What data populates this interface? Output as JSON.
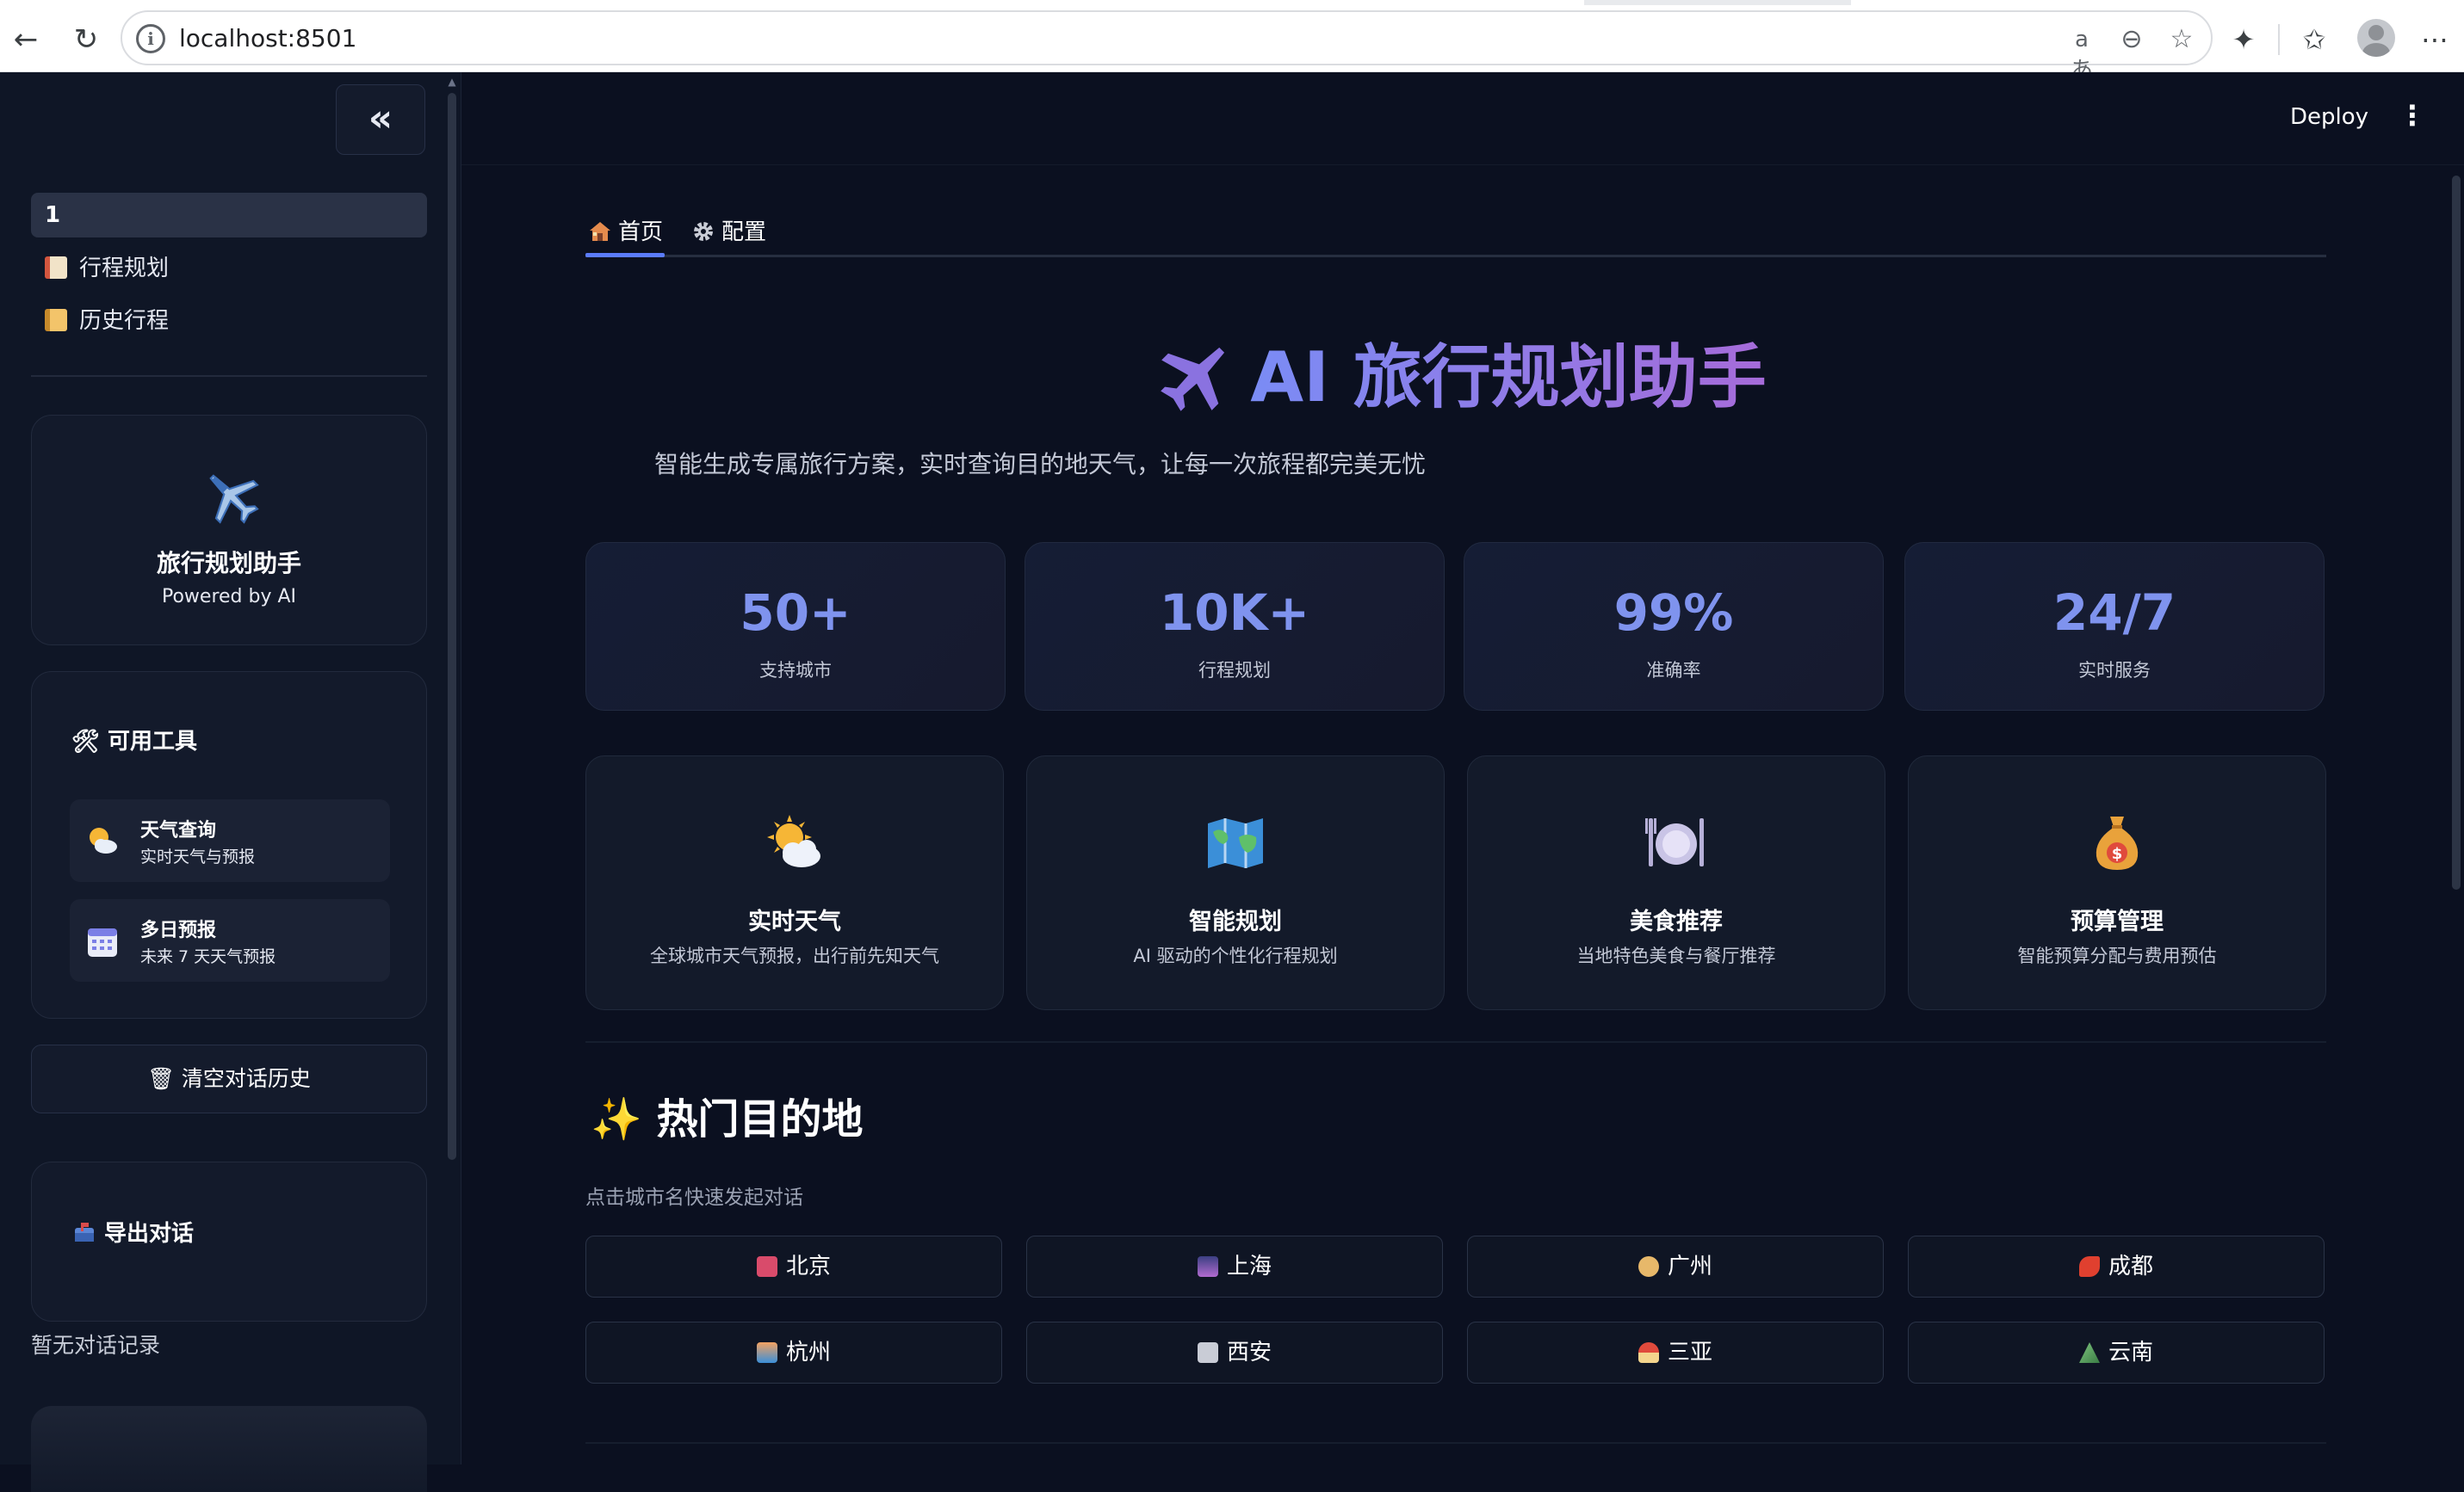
{
  "browser": {
    "url": "localhost:8501"
  },
  "sidebar": {
    "collapse_label": "«",
    "active_page": "1",
    "pages": [
      {
        "label": "行程规划"
      },
      {
        "label": "历史行程"
      }
    ],
    "brand": {
      "title": "旅行规划助手",
      "subtitle": "Powered by AI"
    },
    "tools": {
      "title": "🛠 可用工具",
      "items": [
        {
          "name": "天气查询",
          "desc": "实时天气与预报"
        },
        {
          "name": "多日预报",
          "desc": "未来 7 天天气预报"
        }
      ]
    },
    "clear_button": "🗑 清空对话历史",
    "export_title": "导出对话",
    "no_history": "暂无对话记录"
  },
  "header": {
    "deploy_label": "Deploy"
  },
  "tabs": [
    {
      "label": "首页"
    },
    {
      "label": "配置"
    }
  ],
  "hero": {
    "title": "AI 旅行规划助手",
    "subtitle": "智能生成专属旅行方案，实时查询目的地天气，让每一次旅程都完美无忧"
  },
  "stats": [
    {
      "value": "50+",
      "label": "支持城市"
    },
    {
      "value": "10K+",
      "label": "行程规划"
    },
    {
      "value": "99%",
      "label": "准确率"
    },
    {
      "value": "24/7",
      "label": "实时服务"
    }
  ],
  "features": [
    {
      "name": "实时天气",
      "desc": "全球城市天气预报，出行前先知天气"
    },
    {
      "name": "智能规划",
      "desc": "AI 驱动的个性化行程规划"
    },
    {
      "name": "美食推荐",
      "desc": "当地特色美食与餐厅推荐"
    },
    {
      "name": "预算管理",
      "desc": "智能预算分配与费用预估"
    }
  ],
  "destinations": {
    "title": "✨ 热门目的地",
    "subtitle": "点击城市名快速发起对话",
    "cities": [
      {
        "label": "北京"
      },
      {
        "label": "上海"
      },
      {
        "label": "广州"
      },
      {
        "label": "成都"
      },
      {
        "label": "杭州"
      },
      {
        "label": "西安"
      },
      {
        "label": "三亚"
      },
      {
        "label": "云南"
      }
    ]
  },
  "colors": {
    "accent": "#7f93ee",
    "tab_indicator": "#5b7cfa",
    "title_gradient_start": "#7a8cf5",
    "title_gradient_end": "#a66bd9",
    "background": "#0b1020"
  }
}
